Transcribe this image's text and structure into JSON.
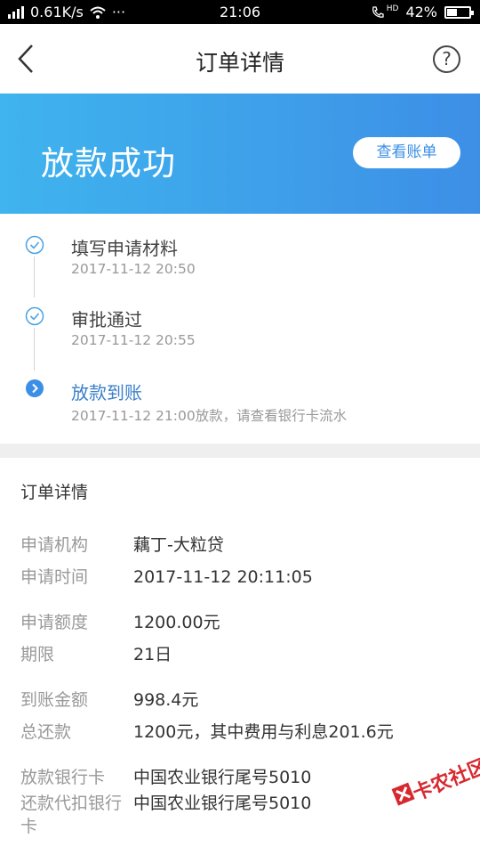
{
  "status_bar": {
    "signal": "4G",
    "speed": "0.61K/s",
    "more": "···",
    "time": "21:06",
    "hd": "HD",
    "battery": "42%",
    "battery_level": 0.42
  },
  "nav": {
    "title": "订单详情",
    "help": "?"
  },
  "banner": {
    "title": "放款成功",
    "bill_button": "查看账单"
  },
  "timeline": [
    {
      "title": "填写申请材料",
      "time": "2017-11-12 20:50",
      "state": "done"
    },
    {
      "title": "审批通过",
      "time": "2017-11-12 20:55",
      "state": "done"
    },
    {
      "title": "放款到账",
      "time": "2017-11-12 21:00放款，请查看银行卡流水",
      "state": "current"
    }
  ],
  "details": {
    "title": "订单详情",
    "rows": [
      {
        "label": "申请机构",
        "value": "藕丁-大粒贷"
      },
      {
        "label": "申请时间",
        "value": "2017-11-12 20:11:05"
      },
      {
        "label": "申请额度",
        "value": "1200.00元"
      },
      {
        "label": "期限",
        "value": "21日"
      },
      {
        "label": "到账金额",
        "value": "998.4元"
      },
      {
        "label": "总还款",
        "value": "1200元，其中费用与利息201.6元"
      },
      {
        "label": "放款银行卡",
        "value": "中国农业银行尾号5010"
      },
      {
        "label": "还款代扣银行",
        "label_cont": "卡",
        "value": "中国农业银行尾号5010"
      }
    ]
  },
  "watermark": {
    "text": "卡农社区"
  },
  "colors": {
    "accent": "#3b8fe6",
    "banner_start": "#3fb4ee",
    "banner_end": "#3d8fe6",
    "active_step": "#3b7fc9",
    "watermark": "#d8282f"
  }
}
